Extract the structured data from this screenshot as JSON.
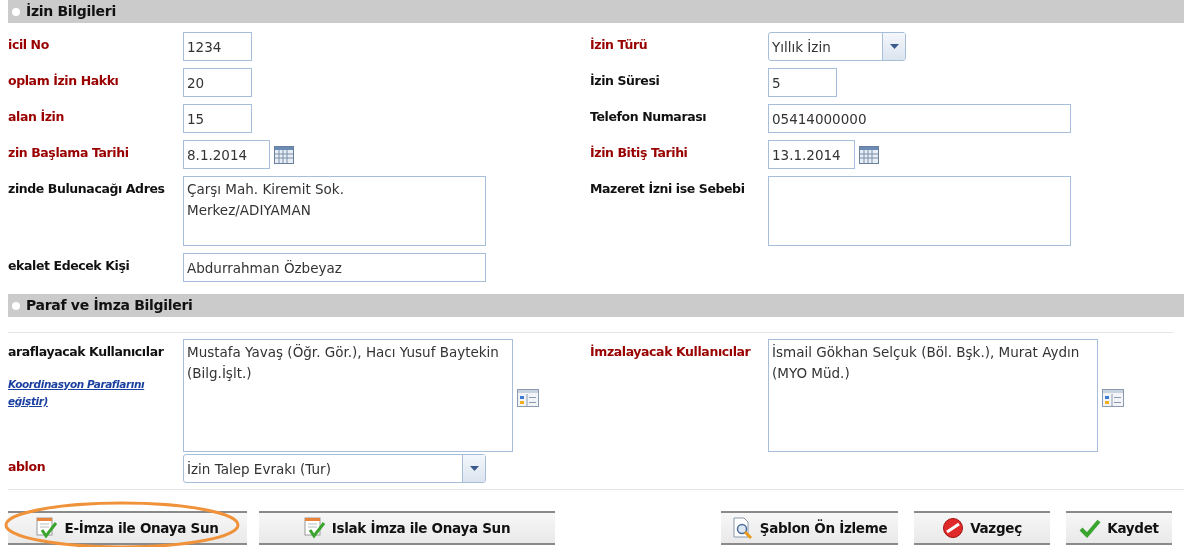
{
  "sections": [
    {
      "title": "İzin Bilgileri",
      "rows": [
        {
          "left": {
            "label": "icil No",
            "required": true,
            "kind": "text",
            "value": "1234"
          },
          "right": {
            "label": "İzin Türü",
            "required": true,
            "kind": "select",
            "value": "Yıllık İzin"
          }
        },
        {
          "left": {
            "label": "oplam İzin Hakkı",
            "required": true,
            "kind": "text",
            "value": "20"
          },
          "right": {
            "label": "İzin Süresi",
            "required": false,
            "kind": "text",
            "value": "5"
          }
        },
        {
          "left": {
            "label": "alan İzin",
            "required": true,
            "kind": "text",
            "value": "15"
          },
          "right": {
            "label": "Telefon Numarası",
            "required": false,
            "kind": "text",
            "value": "05414000000"
          }
        },
        {
          "left": {
            "label": "zin Başlama Tarihi",
            "required": true,
            "kind": "date",
            "value": "8.1.2014"
          },
          "right": {
            "label": "İzin Bitiş Tarihi",
            "required": true,
            "kind": "date",
            "value": "13.1.2014"
          }
        },
        {
          "left": {
            "label": "zinde Bulunacağı Adres",
            "required": false,
            "kind": "textarea",
            "value": "Çarşı Mah. Kiremit Sok.\nMerkez/ADIYAMAN"
          },
          "right": {
            "label": "Mazeret İzni ise Sebebi",
            "required": false,
            "kind": "textarea"
          }
        },
        {
          "left": {
            "label": "ekalet Edecek Kişi",
            "required": false,
            "kind": "text",
            "value": "Abdurrahman Özbeyaz"
          }
        }
      ]
    },
    {
      "title": "Paraf ve İmza Bilgileri",
      "rows": [
        {
          "left": {
            "label": "araflayacak Kullanıcılar",
            "required": false,
            "link": "Koordinasyon Paraflarını eğiştir)",
            "kind": "picker",
            "value": "Mustafa Yavaş (Öğr. Gör.), Hacı Yusuf Baytekin (Bilg.İşlt.)"
          },
          "right": {
            "label": "İmzalayacak Kullanıcılar",
            "required": true,
            "kind": "picker",
            "value": "İsmail Gökhan Selçuk (Böl. Bşk.), Murat Aydın (MYO Müd.)"
          }
        },
        {
          "left": {
            "label": "ablon",
            "required": true,
            "kind": "select",
            "value": "İzin Talep Evrakı (Tur)"
          }
        }
      ]
    }
  ],
  "left_buttons": [
    {
      "label": "E-İmza ile Onaya Sun",
      "highlighted": true
    },
    {
      "label": "Islak İmza ile Onaya Sun",
      "highlighted": false
    }
  ],
  "right_buttons": [
    {
      "label": "Şablon Ön İzleme",
      "highlighted": false
    },
    {
      "label": "Vazgeç",
      "highlighted": false
    },
    {
      "label": "Kaydet",
      "highlighted": false
    }
  ]
}
